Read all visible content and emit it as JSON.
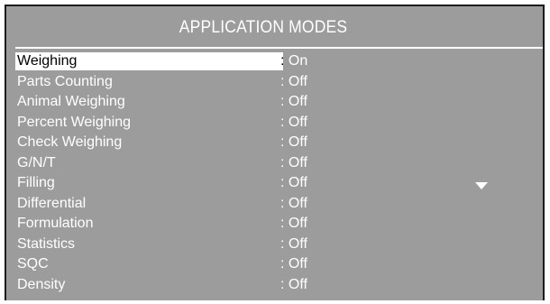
{
  "title": "APPLICATION MODES",
  "items": [
    {
      "label": "Weighing",
      "value": ": On"
    },
    {
      "label": "Parts Counting",
      "value": ": Off"
    },
    {
      "label": "Animal Weighing",
      "value": ": Off"
    },
    {
      "label": "Percent Weighing",
      "value": ": Off"
    },
    {
      "label": "Check Weighing",
      "value": ": Off"
    },
    {
      "label": "G/N/T",
      "value": ": Off"
    },
    {
      "label": "Filling",
      "value": ": Off"
    },
    {
      "label": "Differential",
      "value": ": Off"
    },
    {
      "label": "Formulation",
      "value": ": Off"
    },
    {
      "label": "Statistics",
      "value": ": Off"
    },
    {
      "label": "SQC",
      "value": ": Off"
    },
    {
      "label": "Density",
      "value": ": Off"
    }
  ],
  "selected_index": 0,
  "scroll_indicator_icon": "triangle-down-icon",
  "colors": {
    "background": "#9c9c9c",
    "text": "#ffffff",
    "highlight": "#ffffff",
    "highlight_text": "#000000",
    "frame": "#1b1b1b"
  }
}
